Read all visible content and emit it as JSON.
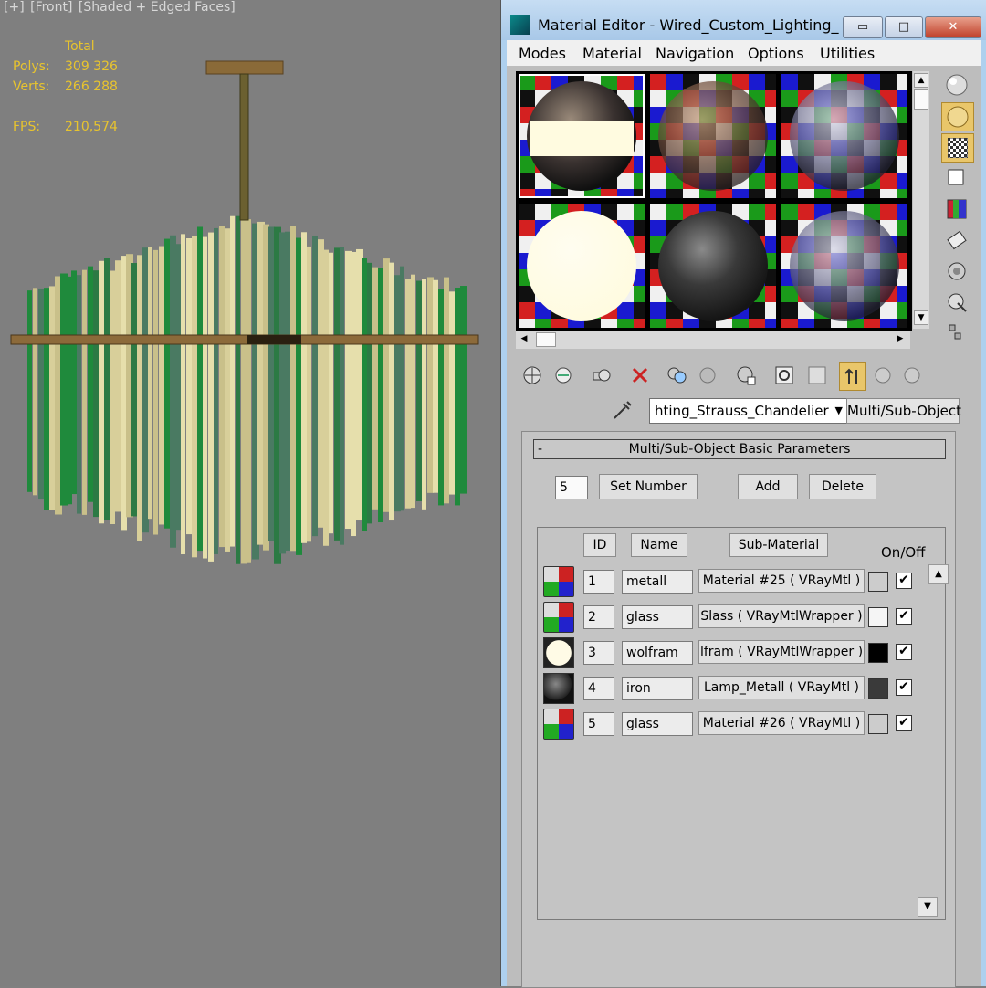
{
  "viewport": {
    "label_parts": [
      "[+]",
      "[Front]",
      "[Shaded + Edged Faces]"
    ],
    "stats": {
      "header": "Total",
      "polys_label": "Polys:",
      "polys_value": "309 326",
      "verts_label": "Verts:",
      "verts_value": "266 288",
      "fps_label": "FPS:",
      "fps_value": "210,574"
    }
  },
  "window": {
    "title": "Material Editor - Wired_Custom_Lighting_S...",
    "minimize": "▭",
    "maximize": "□",
    "close": "✕"
  },
  "menu": [
    "Modes",
    "Material",
    "Navigation",
    "Options",
    "Utilities"
  ],
  "material": {
    "name": "hting_Strauss_Chandelier",
    "type_button": "Multi/Sub-Object",
    "dropdown_arrow": "▼"
  },
  "rollout": {
    "title": "Multi/Sub-Object Basic Parameters",
    "collapse_symbol": "-",
    "count_value": "5",
    "set_number": "Set Number",
    "add": "Add",
    "delete": "Delete",
    "headers": {
      "id": "ID",
      "name": "Name",
      "sub_material": "Sub-Material",
      "on_off": "On/Off"
    },
    "rows": [
      {
        "id": "1",
        "name": "metall",
        "sub_material": "Material #25  ( VRayMtl )",
        "swatch": "#cccccc",
        "on": true,
        "thumb": "checker"
      },
      {
        "id": "2",
        "name": "glass",
        "sub_material": "Slass  ( VRayMtlWrapper )",
        "swatch": "#f5f5f5",
        "on": true,
        "thumb": "glass"
      },
      {
        "id": "3",
        "name": "wolfram",
        "sub_material": "lfram  ( VRayMtlWrapper )",
        "swatch": "#000000",
        "on": true,
        "thumb": "cream"
      },
      {
        "id": "4",
        "name": "iron",
        "sub_material": "Lamp_Metall  ( VRayMtl )",
        "swatch": "#3a3a3a",
        "on": true,
        "thumb": "dark"
      },
      {
        "id": "5",
        "name": "glass",
        "sub_material": "Material #26  ( VRayMtl )",
        "swatch": "#cccccc",
        "on": true,
        "thumb": "glass"
      }
    ]
  },
  "slots": [
    "metal-band",
    "checker-sphere",
    "glass-sphere",
    "cream-sphere",
    "dark-sphere",
    "glass-sphere-2"
  ],
  "colors": {
    "accent": "#e8c42e",
    "title_bar": "#aed0ee",
    "panel": "#c4c4c4"
  }
}
